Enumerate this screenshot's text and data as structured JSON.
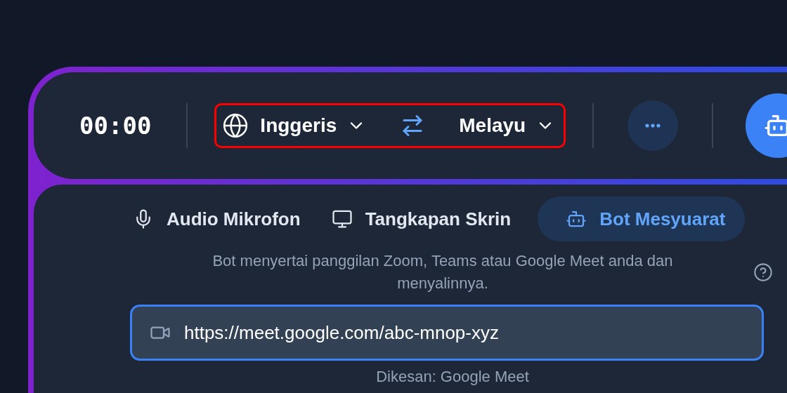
{
  "timer": "00:00",
  "language_selector": {
    "highlighted": true,
    "source": "Inggeris",
    "target": "Melayu"
  },
  "tabs": [
    {
      "label": "Audio Mikrofon",
      "selected": false
    },
    {
      "label": "Tangkapan Skrin",
      "selected": false
    },
    {
      "label": "Bot Mesyuarat",
      "selected": true
    }
  ],
  "description": "Bot menyertai panggilan Zoom, Teams atau Google Meet anda dan menyalinnya.",
  "url_field": {
    "value": "https://meet.google.com/abc-mnop-xyz",
    "focused": true
  },
  "detected": "Dikesan: Google Meet"
}
